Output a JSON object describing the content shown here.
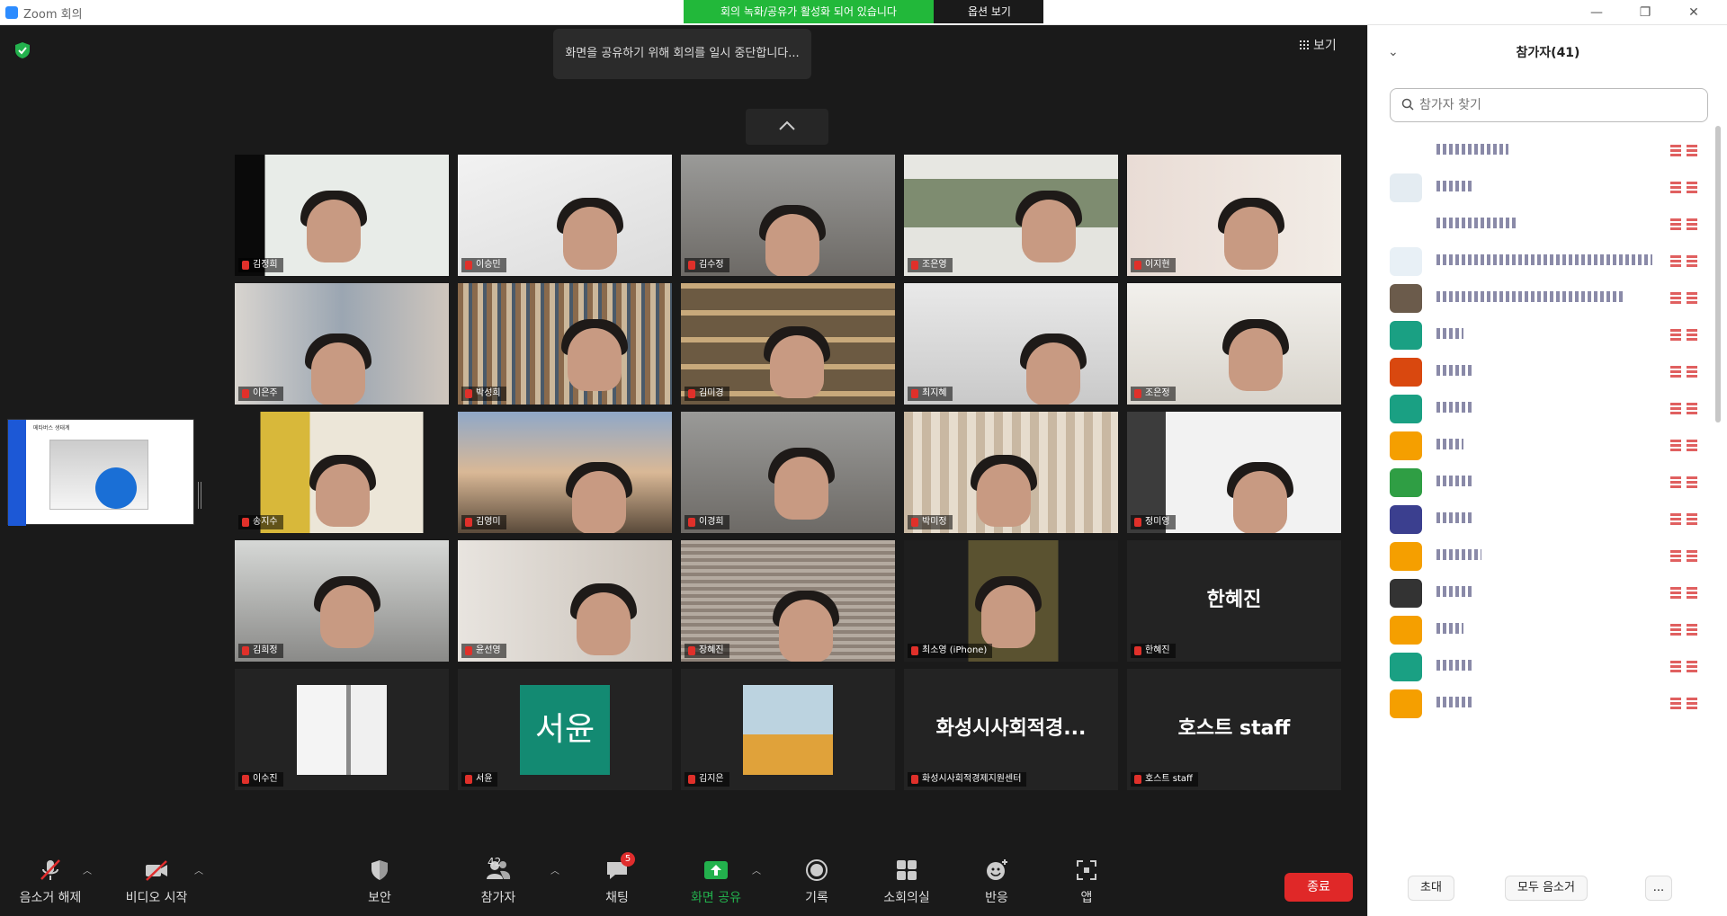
{
  "window": {
    "title": "Zoom 회의"
  },
  "sharebar": {
    "status": "회의 녹화/공유가 활성화 되어 있습니다",
    "options": "옵션 보기"
  },
  "notice": "화면을 공유하기 위해 회의를 일시 중단합니다...",
  "view_label": "보기",
  "side_thumbnail": {
    "caption": "메타버스 생태계"
  },
  "tiles": [
    {
      "name": "김정희",
      "scene": "room-teal"
    },
    {
      "name": "이승민",
      "scene": "room-white"
    },
    {
      "name": "김수정",
      "scene": "room-gray"
    },
    {
      "name": "조은영",
      "scene": "window"
    },
    {
      "name": "이지현",
      "scene": "decor"
    },
    {
      "name": "이은주",
      "scene": "books-blur"
    },
    {
      "name": "박성희",
      "scene": "bookshelf"
    },
    {
      "name": "김미경",
      "scene": "bookshelf2"
    },
    {
      "name": "최지혜",
      "scene": "plain"
    },
    {
      "name": "조은정",
      "scene": "lamps"
    },
    {
      "name": "송지수",
      "scene": "yellow"
    },
    {
      "name": "김영미",
      "scene": "sky"
    },
    {
      "name": "이경희",
      "scene": "room-gray"
    },
    {
      "name": "박미정",
      "scene": "bookshelf3"
    },
    {
      "name": "정미영",
      "scene": "white-room"
    },
    {
      "name": "김희정",
      "scene": "office"
    },
    {
      "name": "윤선영",
      "scene": "curtain"
    },
    {
      "name": "장혜진",
      "scene": "blinds"
    },
    {
      "name": "최소영 (iPhone)",
      "scene": "mask"
    },
    {
      "name": "한혜진",
      "scene": "name-only",
      "display": "한혜진"
    },
    {
      "name": "이수진",
      "scene": "thumb-room"
    },
    {
      "name": "서윤",
      "scene": "avatar-teal",
      "display": "서윤"
    },
    {
      "name": "김지은",
      "scene": "thumb-flowers"
    },
    {
      "name": "화성시사회적경제지원센터",
      "scene": "name-only",
      "display": "화성시사회적경..."
    },
    {
      "name": "호스트 staff",
      "scene": "name-only",
      "display": "호스트 staff"
    }
  ],
  "toolbar": {
    "mute": "음소거 해제",
    "video": "비디오 시작",
    "security": "보안",
    "participants": "참가자",
    "participants_count": "42",
    "chat": "채팅",
    "chat_badge": "5",
    "share": "화면 공유",
    "record": "기록",
    "breakout": "소회의실",
    "reactions": "반응",
    "apps": "앱",
    "end": "종료"
  },
  "panel": {
    "title": "참가자(41)",
    "search_placeholder": "참가자 찾기",
    "invite": "초대",
    "mute_all": "모두 음소거",
    "more": "..."
  },
  "participants": [
    {
      "avatar_color": "#ffffff",
      "w": 80
    },
    {
      "avatar_color": "#e4ecf2",
      "w": 40
    },
    {
      "avatar_color": "#ffffff",
      "w": 90
    },
    {
      "avatar_color": "#e8f0f6",
      "w": 240
    },
    {
      "avatar_color": "#6b5b4b",
      "w": 210
    },
    {
      "avatar_color": "#1aa083",
      "w": 30
    },
    {
      "avatar_color": "#d9480f",
      "w": 40
    },
    {
      "avatar_color": "#1aa083",
      "w": 40
    },
    {
      "avatar_color": "#f59f00",
      "w": 30
    },
    {
      "avatar_color": "#2f9e44",
      "w": 40
    },
    {
      "avatar_color": "#3b3f8f",
      "w": 40
    },
    {
      "avatar_color": "#f59f00",
      "w": 50
    },
    {
      "avatar_color": "#333333",
      "w": 40
    },
    {
      "avatar_color": "#f59f00",
      "w": 30
    },
    {
      "avatar_color": "#1aa083",
      "w": 40
    },
    {
      "avatar_color": "#f59f00",
      "w": 40
    }
  ]
}
